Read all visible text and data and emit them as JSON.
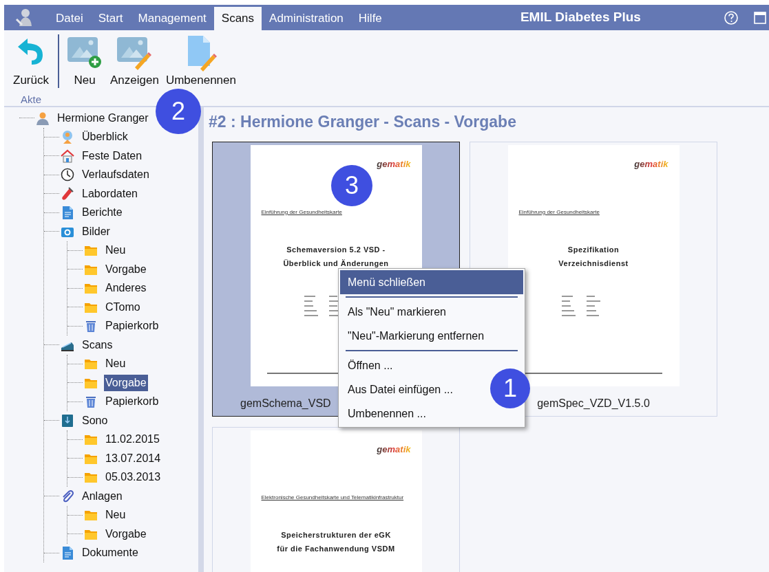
{
  "menu_bar": {
    "tabs": [
      {
        "label": "Datei",
        "selected": false
      },
      {
        "label": "Start",
        "selected": false
      },
      {
        "label": "Management",
        "selected": false
      },
      {
        "label": "Scans",
        "selected": true
      },
      {
        "label": "Administration",
        "selected": false
      },
      {
        "label": "Hilfe",
        "selected": false
      }
    ],
    "app_title": "EMIL Diabetes Plus"
  },
  "ribbon": {
    "groups": [
      {
        "label": "Akte",
        "buttons": [
          {
            "label": "Zurück",
            "kind": "back"
          }
        ]
      },
      {
        "buttons": [
          {
            "label": "Neu",
            "kind": "add"
          },
          {
            "label": "Anzeigen",
            "kind": "show"
          },
          {
            "label": "Umbenennen",
            "kind": "rename"
          }
        ]
      }
    ]
  },
  "tree": {
    "label": "Hermione Granger",
    "kind": "patient",
    "selected": false,
    "children": [
      {
        "label": "Überblick",
        "kind": "overview",
        "selected": false
      },
      {
        "label": "Feste Daten",
        "kind": "fixed",
        "selected": false
      },
      {
        "label": "Verlaufsdaten",
        "kind": "history",
        "selected": false
      },
      {
        "label": "Labordaten",
        "kind": "lab",
        "selected": false
      },
      {
        "label": "Berichte",
        "kind": "reports",
        "selected": false
      },
      {
        "label": "Bilder",
        "kind": "images",
        "selected": false,
        "children": [
          {
            "label": "Neu",
            "kind": "folder",
            "selected": false
          },
          {
            "label": "Vorgabe",
            "kind": "folder",
            "selected": false
          },
          {
            "label": "Anderes",
            "kind": "folder",
            "selected": false
          },
          {
            "label": "CTomo",
            "kind": "folder",
            "selected": false
          },
          {
            "label": "Papierkorb",
            "kind": "bin",
            "selected": false
          }
        ]
      },
      {
        "label": "Scans",
        "kind": "scans",
        "selected": false,
        "children": [
          {
            "label": "Neu",
            "kind": "folder",
            "selected": false
          },
          {
            "label": "Vorgabe",
            "kind": "folder",
            "selected": true
          },
          {
            "label": "Papierkorb",
            "kind": "bin",
            "selected": false
          }
        ]
      },
      {
        "label": "Sono",
        "kind": "sono",
        "selected": false,
        "children": [
          {
            "label": "11.02.2015",
            "kind": "folder",
            "selected": false
          },
          {
            "label": "13.07.2014",
            "kind": "folder",
            "selected": false
          },
          {
            "label": "05.03.2013",
            "kind": "folder",
            "selected": false
          }
        ]
      },
      {
        "label": "Anlagen",
        "kind": "attachments",
        "selected": false,
        "children": [
          {
            "label": "Neu",
            "kind": "folder",
            "selected": false
          },
          {
            "label": "Vorgabe",
            "kind": "folder",
            "selected": false
          }
        ]
      },
      {
        "label": "Dokumente",
        "kind": "reports",
        "selected": false
      }
    ]
  },
  "heading": "#2 : Hermione Granger - Scans - Vorgabe",
  "thumbnails": [
    {
      "caption": "gemSchema_VSD",
      "selected": true,
      "page": {
        "logo": "gematik",
        "subtitle": "Einführung der Gesundheitskarte",
        "title_lines": [
          "Schemaversion 5.2 VSD -",
          "Überblick und Änderungen"
        ]
      }
    },
    {
      "caption": "gemSpec_VZD_V1.5.0",
      "selected": false,
      "page": {
        "logo": "gematik",
        "subtitle": "Einführung der Gesundheitskarte",
        "title_lines": [
          "Spezifikation",
          "Verzeichnisdienst"
        ]
      }
    },
    {
      "selected": false,
      "page": {
        "logo": "gematik",
        "subtitle": "Elektronische Gesundheitskarte und Telematikinfrastruktur",
        "title_lines": [
          "Speicherstrukturen der eGK",
          "für die Fachanwendung VSDM"
        ]
      }
    }
  ],
  "context_menu": {
    "items": [
      {
        "kind": "item",
        "label": "Menü schließen",
        "selected": true
      },
      {
        "kind": "separator"
      },
      {
        "kind": "item",
        "label": "Als \"Neu\" markieren",
        "selected": false
      },
      {
        "kind": "item",
        "label": "\"Neu\"-Markierung entfernen",
        "selected": false
      },
      {
        "kind": "separator"
      },
      {
        "kind": "item",
        "label": "Öffnen ...",
        "selected": false
      },
      {
        "kind": "item",
        "label": "Aus Datei einfügen ...",
        "selected": false
      },
      {
        "kind": "item",
        "label": "Umbenennen ...",
        "selected": false
      }
    ]
  },
  "badges": [
    {
      "number": "1"
    },
    {
      "number": "2"
    },
    {
      "number": "3"
    }
  ]
}
